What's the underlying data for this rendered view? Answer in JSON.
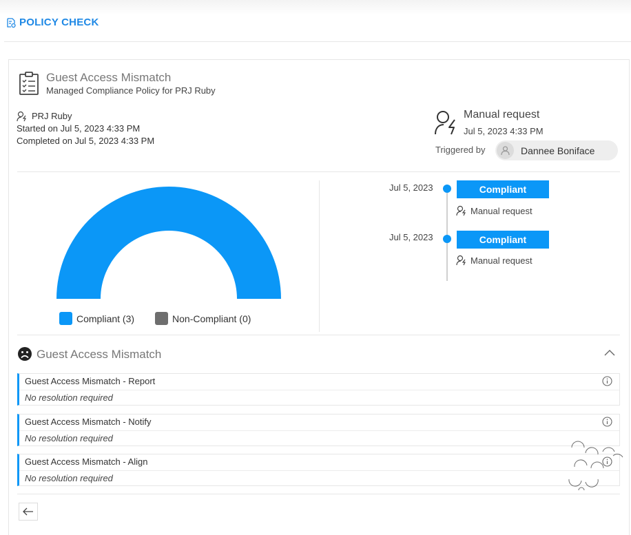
{
  "header": {
    "title": "POLICY CHECK"
  },
  "policy": {
    "name": "Guest Access Mismatch",
    "description": "Managed Compliance Policy for PRJ Ruby"
  },
  "run": {
    "project": "PRJ Ruby",
    "started": "Started on Jul 5, 2023 4:33 PM",
    "completed": "Completed on Jul 5, 2023 4:33 PM"
  },
  "request": {
    "type": "Manual request",
    "date": "Jul 5, 2023 4:33 PM",
    "triggered_label": "Triggered by",
    "user": "Dannee Boniface"
  },
  "chart_data": {
    "type": "pie",
    "title": "",
    "categories": [
      "Compliant",
      "Non-Compliant"
    ],
    "values": [
      3,
      0
    ],
    "legend": [
      "Compliant (3)",
      "Non-Compliant (0)"
    ],
    "colors": [
      "#0b97f7",
      "#6e6e6e"
    ],
    "legend_position": "bottom"
  },
  "timeline": [
    {
      "date": "Jul 5, 2023",
      "status": "Compliant",
      "source": "Manual request"
    },
    {
      "date": "Jul 5, 2023",
      "status": "Compliant",
      "source": "Manual request"
    }
  ],
  "section": {
    "title": "Guest Access Mismatch"
  },
  "resolutions": [
    {
      "title": "Guest Access Mismatch - Report",
      "note": "No resolution required"
    },
    {
      "title": "Guest Access Mismatch - Notify",
      "note": "No resolution required"
    },
    {
      "title": "Guest Access Mismatch - Align",
      "note": "No resolution required"
    }
  ],
  "colors": {
    "accent": "#0b97f7",
    "title_blue": "#1e88e5",
    "non_compliant": "#6e6e6e"
  }
}
